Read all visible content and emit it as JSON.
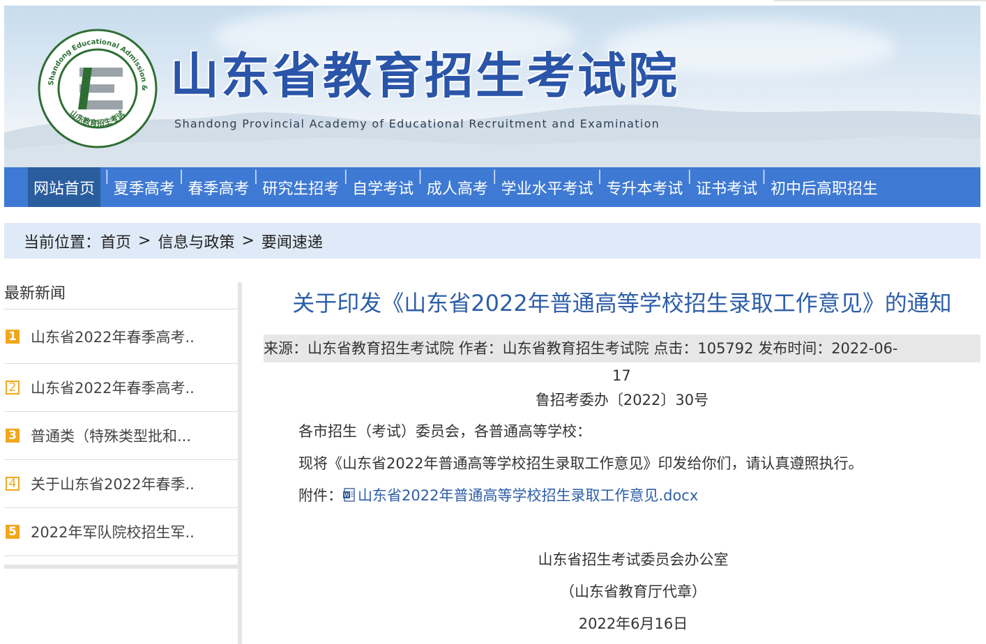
{
  "header": {
    "title": "山东省教育招生考试院",
    "subtitle": "Shandong Provincial Academy of Educational Recruitment and Examination",
    "logo": {
      "ring_text_en": "Shandong Educational Admission & Examinations",
      "ring_text_cn": "山东教育招生考试",
      "letter": "E",
      "colors": {
        "green": "#2e6e33",
        "gray": "#9aa3a8"
      }
    }
  },
  "nav": {
    "items": [
      "网站首页",
      "夏季高考",
      "春季高考",
      "研究生招考",
      "自学考试",
      "成人高考",
      "学业水平考试",
      "专升本考试",
      "证书考试",
      "初中后高职招生"
    ],
    "separator": "|",
    "active_color": "#2a5d9e",
    "bar_color": "#3e79d3"
  },
  "breadcrumb": {
    "label": "当前位置：",
    "items": [
      "首页",
      "信息与政策",
      "要闻速递"
    ],
    "separator": ">"
  },
  "sidebar": {
    "title": "最新新闻",
    "items": [
      {
        "num": "1",
        "text": "山东省2022年春季高考.."
      },
      {
        "num": "2",
        "text": "山东省2022年春季高考.."
      },
      {
        "num": "3",
        "text": "普通类（特殊类型批和..."
      },
      {
        "num": "4",
        "text": "关于山东省2022年春季.."
      },
      {
        "num": "5",
        "text": "2022年军队院校招生军.."
      }
    ],
    "accent": "#f0a71c"
  },
  "article": {
    "title": "关于印发《山东省2022年普通高等学校招生录取工作意见》的通知",
    "meta_line": "来源：山东省教育招生考试院 作者：山东省教育招生考试院 点击：105792 发布时间：2022-06-",
    "meta_wrap": "17",
    "doc_number": "鲁招考委办〔2022〕30号",
    "salutation": "各市招生（考试）委员会，各普通高等学校：",
    "body": "现将《山东省2022年普通高等学校招生录取工作意见》印发给你们，请认真遵照执行。",
    "attachment_label": "附件：",
    "attachment_name": "山东省2022年普通高等学校招生录取工作意见.docx",
    "issuer": "山东省招生考试委员会办公室",
    "seal": "（山东省教育厅代章）",
    "date": "2022年6月16日",
    "title_color": "#2d5ea8"
  }
}
